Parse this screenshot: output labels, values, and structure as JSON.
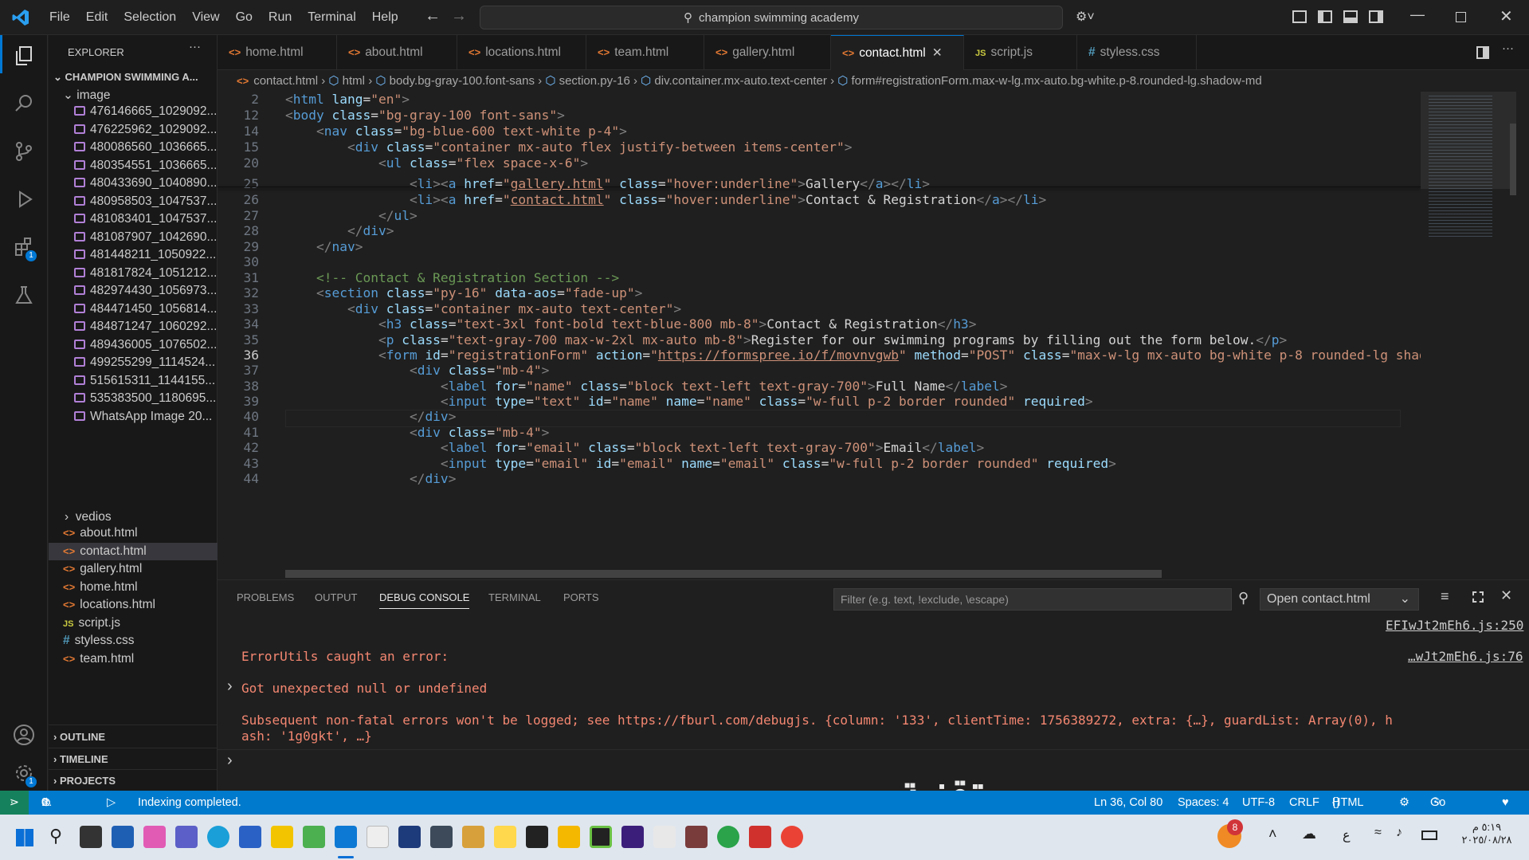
{
  "menu": [
    "File",
    "Edit",
    "Selection",
    "View",
    "Go",
    "Run",
    "Terminal",
    "Help"
  ],
  "command_center": "champion swimming academy",
  "explorer": {
    "title": "EXPLORER",
    "project": "CHAMPION SWIMMING A...",
    "folder_image": "image",
    "images": [
      "476146665_1029092...",
      "476225962_1029092...",
      "480086560_1036665...",
      "480354551_1036665...",
      "480433690_1040890...",
      "480958503_1047537...",
      "481083401_1047537...",
      "481087907_1042690...",
      "481448211_1050922...",
      "481817824_1051212...",
      "482974430_1056973...",
      "484471450_1056814...",
      "484871247_1060292...",
      "489436005_1076502...",
      "499255299_1114524...",
      "515615311_1144155...",
      "535383500_1180695...",
      "WhatsApp Image 20..."
    ],
    "folder_vedios": "vedios",
    "files": [
      {
        "name": "about.html",
        "type": "html"
      },
      {
        "name": "contact.html",
        "type": "html"
      },
      {
        "name": "gallery.html",
        "type": "html"
      },
      {
        "name": "home.html",
        "type": "html"
      },
      {
        "name": "locations.html",
        "type": "html"
      },
      {
        "name": "script.js",
        "type": "js"
      },
      {
        "name": "styless.css",
        "type": "css"
      },
      {
        "name": "team.html",
        "type": "html"
      }
    ],
    "outline": "OUTLINE",
    "timeline": "TIMELINE",
    "projects": "PROJECTS"
  },
  "tabs": [
    "home.html",
    "about.html",
    "locations.html",
    "team.html",
    "gallery.html",
    "contact.html",
    "script.js",
    "styless.css"
  ],
  "active_tab": "contact.html",
  "breadcrumbs": [
    "contact.html",
    "html",
    "body.bg-gray-100.font-sans",
    "section.py-16",
    "div.container.mx-auto.text-center",
    "form#registrationForm.max-w-lg.mx-auto.bg-white.p-8.rounded-lg.shadow-md"
  ],
  "line_numbers": [
    "2",
    "12",
    "14",
    "15",
    "20",
    "25",
    "26",
    "27",
    "28",
    "29",
    "30",
    "31",
    "32",
    "33",
    "34",
    "35",
    "36",
    "37",
    "38",
    "39",
    "40",
    "41",
    "42",
    "43",
    "44"
  ],
  "panel": {
    "tabs": [
      "PROBLEMS",
      "OUTPUT",
      "DEBUG CONSOLE",
      "TERMINAL",
      "PORTS"
    ],
    "filter_placeholder": "Filter (e.g. text, !exclude, \\escape)",
    "open_select": "Open contact.html",
    "source1": "EFIwJt2mEh6.js:250",
    "source2": "…wJt2mEh6.js:76",
    "line1": "ErrorUtils caught an error:",
    "line2": "Got unexpected null or undefined",
    "line3": "Subsequent non-fatal errors won't be logged; see https://fburl.com/debugjs. {column: '133', clientTime: 1756389272, extra: {…}, guardList: Array(0), h",
    "line4": "ash: '1g0gkt', …}"
  },
  "status": {
    "errors": "0",
    "warnings": "0",
    "message": "Indexing completed.",
    "position": "Ln 36, Col 80",
    "spaces": "Spaces: 4",
    "encoding": "UTF-8",
    "eol": "CRLF",
    "language": "HTML",
    "golive": "Go Live"
  },
  "taskbar": {
    "time": "٥:١٩ م",
    "date": "٢٠٢٥/٠٨/٢٨",
    "lang": "ع",
    "notif": "8"
  },
  "watermark": "تقنية",
  "colors": {
    "accent": "#0078d4",
    "status": "#007acc",
    "error": "#f48771"
  }
}
